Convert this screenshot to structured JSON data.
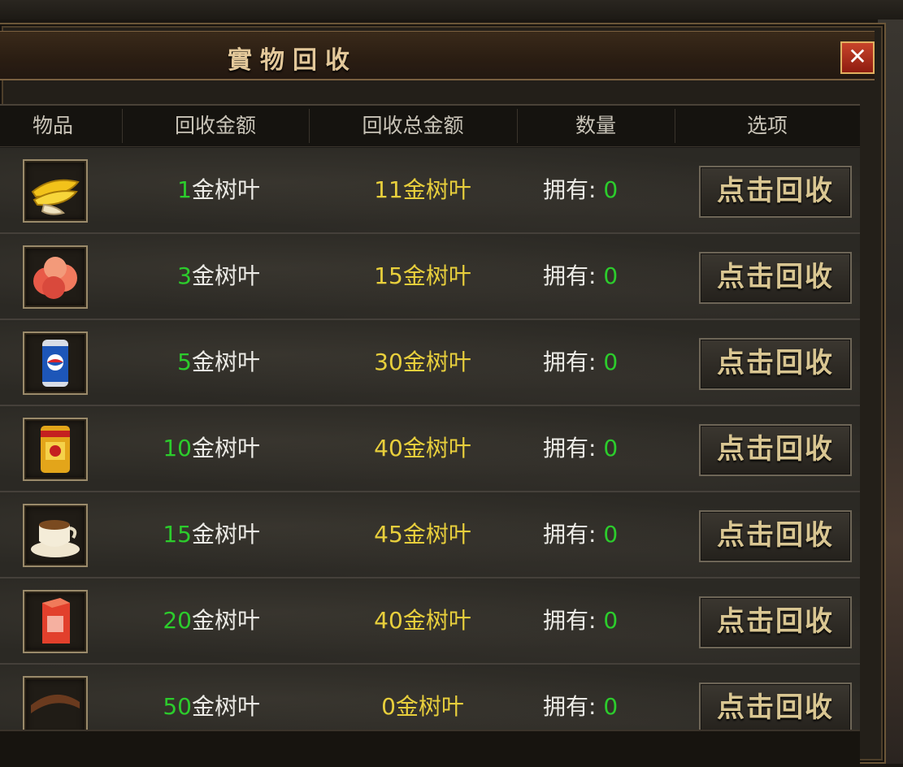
{
  "window": {
    "title": "實物回收",
    "close_label": "✕"
  },
  "table": {
    "headers": [
      "物品",
      "回收金额",
      "回收总金额",
      "数量",
      "选项"
    ],
    "unit": "金树叶",
    "own_label": "拥有:",
    "button_label": "点击回收",
    "rows": [
      {
        "item_icon": "banana-icon",
        "amount": "1",
        "total": "11",
        "owned": "0"
      },
      {
        "item_icon": "peach-icon",
        "amount": "3",
        "total": "15",
        "owned": "0"
      },
      {
        "item_icon": "cola-can-icon",
        "amount": "5",
        "total": "30",
        "owned": "0"
      },
      {
        "item_icon": "energy-drink-icon",
        "amount": "10",
        "total": "40",
        "owned": "0"
      },
      {
        "item_icon": "coffee-cup-icon",
        "amount": "15",
        "total": "45",
        "owned": "0"
      },
      {
        "item_icon": "juice-box-icon",
        "amount": "20",
        "total": "40",
        "owned": "0"
      },
      {
        "item_icon": "food-item-icon",
        "amount": "50",
        "total": "0",
        "owned": "0"
      }
    ]
  },
  "colors": {
    "accent_gold": "#e3c89a",
    "value_green": "#2ccc2c",
    "value_yellow": "#e8cf3c"
  }
}
